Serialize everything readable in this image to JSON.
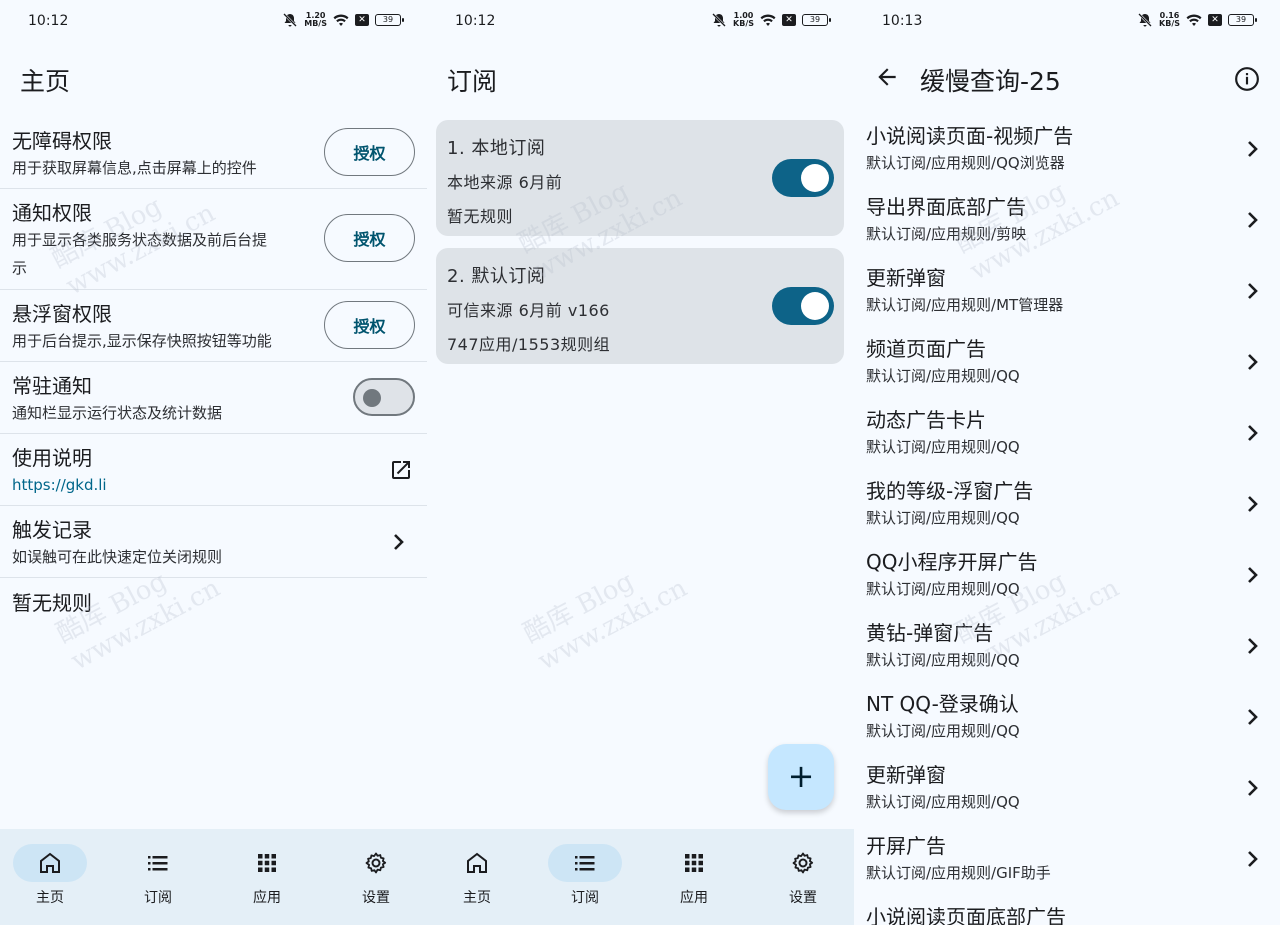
{
  "colors": {
    "accent": "#0d6388",
    "background": "#f6faff",
    "card": "#dee3e8",
    "nav": "#e4eff7"
  },
  "panel1": {
    "status": {
      "time": "10:12",
      "speed_value": "1.20",
      "speed_unit": "MB/S",
      "battery": "39"
    },
    "title": "主页",
    "rows": [
      {
        "title": "无障碍权限",
        "desc": "用于获取屏幕信息,点击屏幕上的控件",
        "button": "授权"
      },
      {
        "title": "通知权限",
        "desc_line1": "用于显示各类服务状态数据及前后台提",
        "desc_line2": "示",
        "button": "授权"
      },
      {
        "title": "悬浮窗权限",
        "desc": "用于后台提示,显示保存快照按钮等功能",
        "button": "授权"
      },
      {
        "title": "常驻通知",
        "desc": "通知栏显示运行状态及统计数据",
        "toggle": "off"
      },
      {
        "title": "使用说明",
        "link": "https://gkd.li",
        "icon": "open-in-new-icon"
      },
      {
        "title": "触发记录",
        "desc": "如误触可在此快速定位关闭规则",
        "icon": "chevron-right-icon"
      },
      {
        "title": "暂无规则"
      }
    ]
  },
  "panel2": {
    "status": {
      "time": "10:12",
      "speed_value": "1.00",
      "speed_unit": "KB/S",
      "battery": "39"
    },
    "title": "订阅",
    "cards": [
      {
        "name": "1. 本地订阅",
        "meta": "本地来源   6月前",
        "info": "暂无规则",
        "toggle": "on"
      },
      {
        "name": "2. 默认订阅",
        "meta": "可信来源   6月前   v166",
        "info": "747应用/1553规则组",
        "toggle": "on"
      }
    ],
    "fab": "+"
  },
  "nav": [
    {
      "label": "主页",
      "icon": "home-icon"
    },
    {
      "label": "订阅",
      "icon": "list-icon"
    },
    {
      "label": "应用",
      "icon": "apps-grid-icon"
    },
    {
      "label": "设置",
      "icon": "gear-icon"
    }
  ],
  "panel3": {
    "status": {
      "time": "10:13",
      "speed_value": "0.16",
      "speed_unit": "KB/S",
      "battery": "39"
    },
    "title": "缓慢查询-25",
    "rules": [
      {
        "title": "小说阅读页面-视频广告",
        "path": "默认订阅/应用规则/QQ浏览器"
      },
      {
        "title": "导出界面底部广告",
        "path": "默认订阅/应用规则/剪映"
      },
      {
        "title": "更新弹窗",
        "path": "默认订阅/应用规则/MT管理器"
      },
      {
        "title": "频道页面广告",
        "path": "默认订阅/应用规则/QQ"
      },
      {
        "title": "动态广告卡片",
        "path": "默认订阅/应用规则/QQ"
      },
      {
        "title": "我的等级-浮窗广告",
        "path": "默认订阅/应用规则/QQ"
      },
      {
        "title": "QQ小程序开屏广告",
        "path": "默认订阅/应用规则/QQ"
      },
      {
        "title": "黄钻-弹窗广告",
        "path": "默认订阅/应用规则/QQ"
      },
      {
        "title": "NT QQ-登录确认",
        "path": "默认订阅/应用规则/QQ"
      },
      {
        "title": "更新弹窗",
        "path": "默认订阅/应用规则/QQ"
      },
      {
        "title": "开屏广告",
        "path": "默认订阅/应用规则/GIF助手"
      },
      {
        "title": "小说阅读页面底部广告",
        "path": ""
      }
    ]
  },
  "watermark": {
    "line1": "酷库 Blog",
    "line2": "www.zxki.cn"
  }
}
